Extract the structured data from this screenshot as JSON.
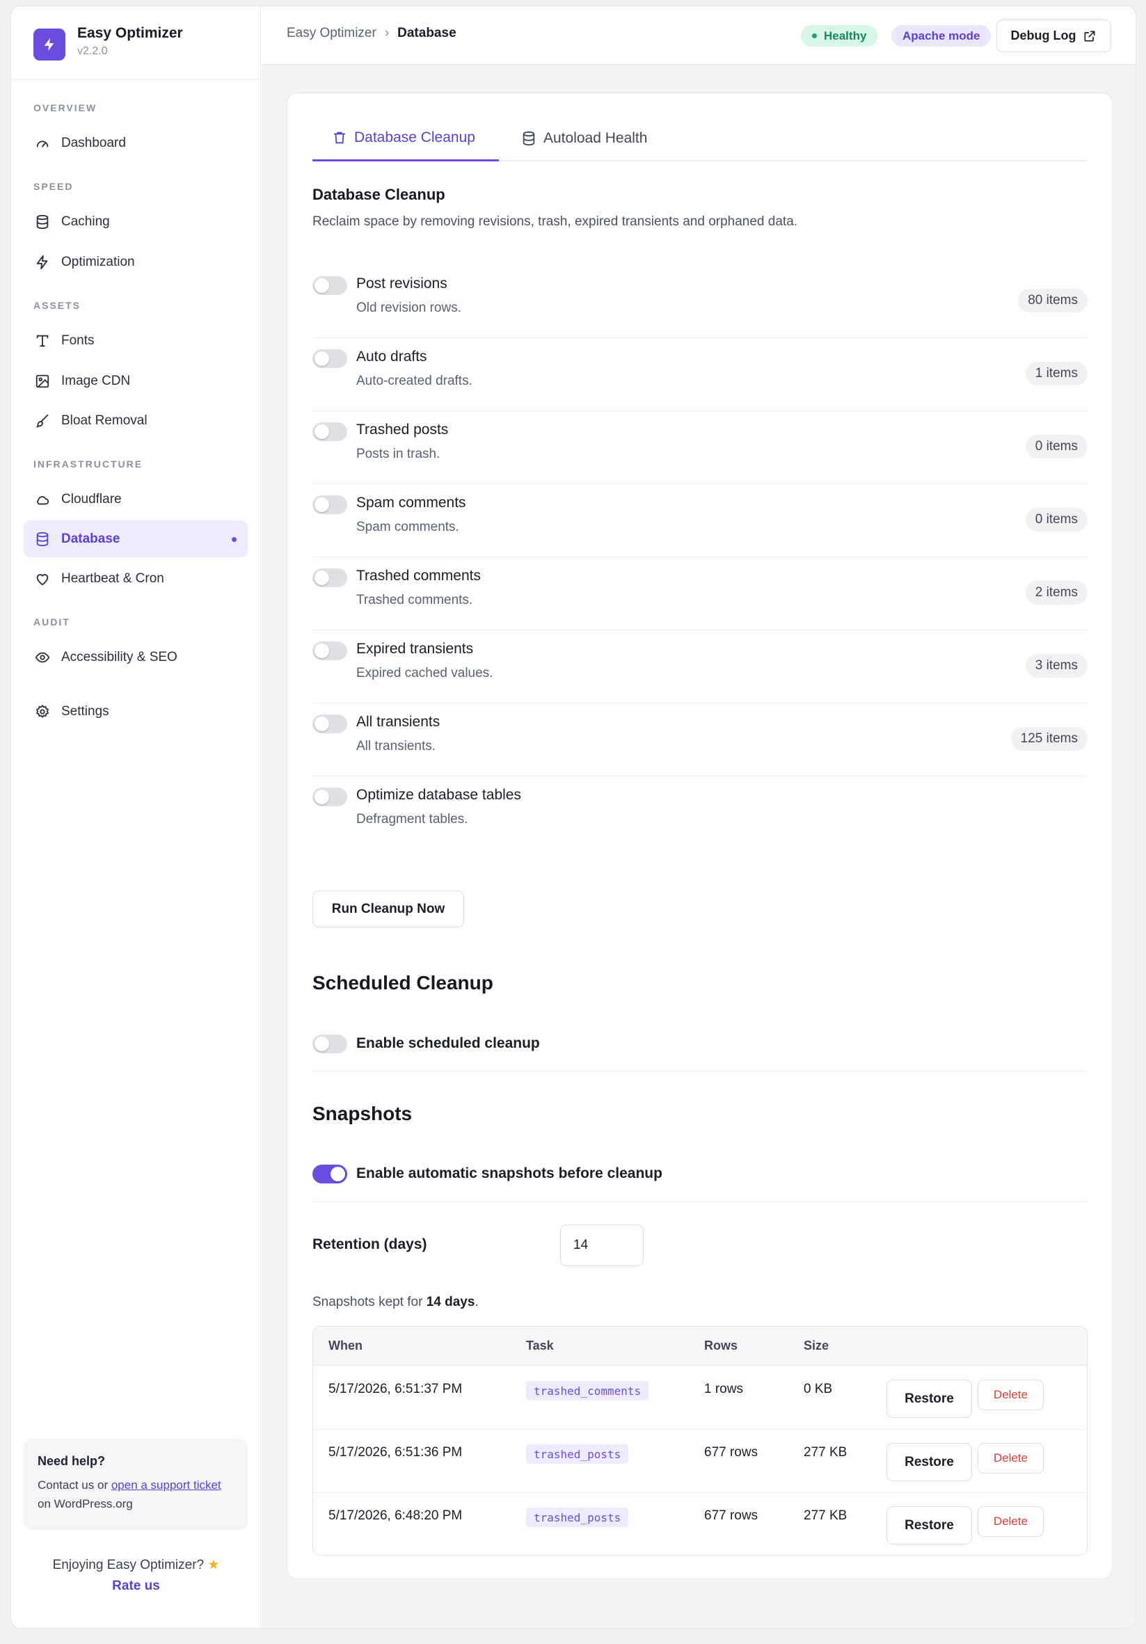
{
  "app": {
    "name": "Easy Optimizer",
    "version": "v2.2.0"
  },
  "sidebar": {
    "sections": {
      "overview": "OVERVIEW",
      "speed": "SPEED",
      "assets": "ASSETS",
      "infrastructure": "INFRASTRUCTURE",
      "audit": "AUDIT"
    },
    "items": {
      "dashboard": "Dashboard",
      "caching": "Caching",
      "optimization": "Optimization",
      "fonts": "Fonts",
      "image_cdn": "Image CDN",
      "bloat_removal": "Bloat Removal",
      "cloudflare": "Cloudflare",
      "database": "Database",
      "heartbeat": "Heartbeat & Cron",
      "accessibility": "Accessibility & SEO",
      "settings": "Settings"
    },
    "active_item": "Database",
    "help": {
      "title": "Need help?",
      "text_before": "Contact us or ",
      "link": "open a support ticket",
      "text_after": " on WordPress.org"
    },
    "rate": {
      "text": "Enjoying Easy Optimizer?",
      "link": "Rate us"
    }
  },
  "header": {
    "breadcrumb": [
      "Easy Optimizer",
      "Database"
    ],
    "status_badge": "Healthy",
    "mode_badge": "Apache mode",
    "debug_button": "Debug Log"
  },
  "tabs": [
    "Database Cleanup",
    "Autoload Health"
  ],
  "active_tab": "Database Cleanup",
  "cleanup": {
    "title": "Database Cleanup",
    "subtitle": "Reclaim space by removing revisions, trash, expired transients and orphaned data.",
    "items": [
      {
        "title": "Post revisions",
        "desc": "Old revision rows.",
        "count": "80 items",
        "enabled": false
      },
      {
        "title": "Auto drafts",
        "desc": "Auto-created drafts.",
        "count": "1 items",
        "enabled": false
      },
      {
        "title": "Trashed posts",
        "desc": "Posts in trash.",
        "count": "0 items",
        "enabled": false
      },
      {
        "title": "Spam comments",
        "desc": "Spam comments.",
        "count": "0 items",
        "enabled": false
      },
      {
        "title": "Trashed comments",
        "desc": "Trashed comments.",
        "count": "2 items",
        "enabled": false
      },
      {
        "title": "Expired transients",
        "desc": "Expired cached values.",
        "count": "3 items",
        "enabled": false
      },
      {
        "title": "All transients",
        "desc": "All transients.",
        "count": "125 items",
        "enabled": false
      },
      {
        "title": "Optimize database tables",
        "desc": "Defragment tables.",
        "count": "",
        "enabled": false
      }
    ],
    "run_button": "Run Cleanup Now"
  },
  "scheduled": {
    "title": "Scheduled Cleanup",
    "toggle_label": "Enable scheduled cleanup",
    "enabled": false
  },
  "snapshots": {
    "title": "Snapshots",
    "toggle_label": "Enable automatic snapshots before cleanup",
    "enabled": true,
    "retention_label": "Retention (days)",
    "retention_value": "14",
    "kept_before": "Snapshots kept for ",
    "kept_bold": "14 days",
    "kept_after": ".",
    "columns": [
      "When",
      "Task",
      "Rows",
      "Size"
    ],
    "rows": [
      {
        "when": "5/17/2026, 6:51:37 PM",
        "task": "trashed_comments",
        "rows": "1 rows",
        "size": "0 KB"
      },
      {
        "when": "5/17/2026, 6:51:36 PM",
        "task": "trashed_posts",
        "rows": "677 rows",
        "size": "277 KB"
      },
      {
        "when": "5/17/2026, 6:48:20 PM",
        "task": "trashed_posts",
        "rows": "677 rows",
        "size": "277 KB"
      }
    ],
    "restore_label": "Restore",
    "delete_label": "Delete"
  },
  "colors": {
    "accent": "#6d4ce0",
    "healthy_bg": "#d7f6e6",
    "healthy_text": "#14895a",
    "danger": "#e03b3b"
  }
}
